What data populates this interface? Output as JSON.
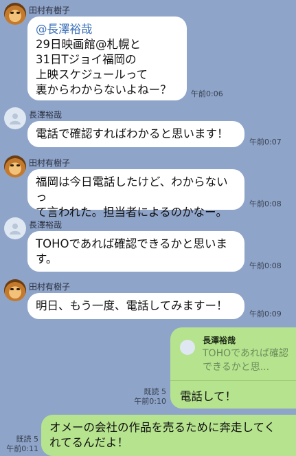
{
  "colors": {
    "background": "#8fa4c9",
    "incoming_bubble": "#ffffff",
    "outgoing_bubble": "#b6e38e",
    "mention": "#3a6fb8"
  },
  "messages": [
    {
      "sender": "田村有樹子",
      "mention": "@長澤裕哉",
      "lines": [
        "29日映画館@札幌と",
        "31日Tジョイ福岡の",
        "上映スケジュールって",
        "裏からわからないよねー？"
      ],
      "time": "午前0:06"
    },
    {
      "sender": "長澤裕哉",
      "lines": [
        "電話で確認すればわかると思います！"
      ],
      "time": "午前0:07"
    },
    {
      "sender": "田村有樹子",
      "lines": [
        "福岡は今日電話したけど、わからないっ",
        "て言われた。担当者によるのかなー。"
      ],
      "time": "午前0:08"
    },
    {
      "sender": "長澤裕哉",
      "lines": [
        "TOHOであれば確認できるかと思いま",
        "す。"
      ],
      "time": "午前0:08"
    },
    {
      "sender": "田村有樹子",
      "lines": [
        "明日、もう一度、電話してみますー！"
      ],
      "time": "午前0:09"
    }
  ],
  "outgoing": [
    {
      "reply_to_name": "長澤裕哉",
      "reply_to_text": "TOHOであれば確認できるかと思...",
      "text": "電話して！",
      "read": "既読 5",
      "time": "午前0:10"
    },
    {
      "lines": [
        "オメーの会社の作品を売るために奔走してく",
        "れてるんだよ！"
      ],
      "read": "既読 5",
      "time": "午前0:11"
    }
  ]
}
